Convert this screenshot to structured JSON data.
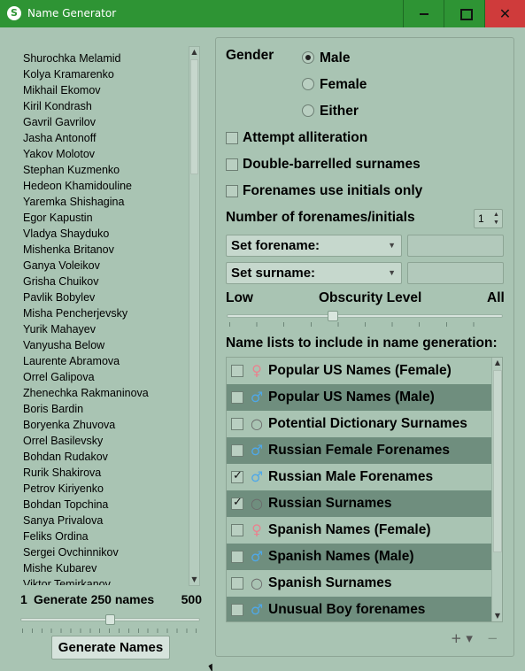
{
  "window": {
    "title": "Name Generator",
    "app_icon_letter": "S",
    "minimize_icon": "minimize-icon",
    "maximize_icon": "maximize-icon",
    "close_label": "✕"
  },
  "names": [
    "Shurochka Melamid",
    "Kolya Kramarenko",
    "Mikhail Ekomov",
    "Kiril Kondrash",
    "Gavril Gavrilov",
    "Jasha Antonoff",
    "Yakov Molotov",
    "Stephan Kuzmenko",
    "Hedeon Khamidouline",
    "Yaremka Shishagina",
    "Egor Kapustin",
    "Vladya Shayduko",
    "Mishenka Britanov",
    "Ganya Voleikov",
    "Grisha Chuikov",
    "Pavlik Bobylev",
    "Misha Pencherjevsky",
    "Yurik Mahayev",
    "Vanyusha Below",
    "Laurente Abramova",
    "Orrel Galipova",
    "Zhenechka Rakmaninova",
    "Boris Bardin",
    "Boryenka Zhuvova",
    "Orrel Basilevsky",
    "Bohdan Rudakov",
    "Rurik Shakirova",
    "Petrov Kiriyenko",
    "Bohdan Topchina",
    "Sanya Privalova",
    "Feliks Ordina",
    "Sergei Ovchinnikov",
    "Mishe Kubarev",
    "Viktor Temirkanov"
  ],
  "generate": {
    "min": "1",
    "label": "Generate 250 names",
    "max": "500",
    "value_fraction": 0.5,
    "button_label": "Generate Names"
  },
  "gender": {
    "label": "Gender",
    "options": [
      "Male",
      "Female",
      "Either"
    ],
    "selected": "Male"
  },
  "options": {
    "alliteration": {
      "label": "Attempt alliteration",
      "checked": false
    },
    "double_barrelled": {
      "label": "Double-barrelled surnames",
      "checked": false
    },
    "initials_only": {
      "label": "Forenames use initials only",
      "checked": false
    }
  },
  "forenames_count": {
    "label": "Number of forenames/initials",
    "value": "1"
  },
  "set_forename": {
    "label": "Set forename:",
    "value": ""
  },
  "set_surname": {
    "label": "Set surname:",
    "value": ""
  },
  "obscurity": {
    "low": "Low",
    "label": "Obscurity Level",
    "high": "All",
    "value_fraction": 0.38
  },
  "name_lists": {
    "label": "Name lists to include in name generation:",
    "items": [
      {
        "label": "Popular US Names (Female)",
        "icon": "female-icon",
        "checked": false
      },
      {
        "label": "Popular US Names (Male)",
        "icon": "male-icon",
        "checked": false
      },
      {
        "label": "Potential Dictionary Surnames",
        "icon": "circle-icon",
        "checked": false
      },
      {
        "label": "Russian Female Forenames",
        "icon": "male-icon",
        "checked": false
      },
      {
        "label": "Russian Male Forenames",
        "icon": "male-icon",
        "checked": true
      },
      {
        "label": "Russian Surnames",
        "icon": "circle-icon",
        "checked": true
      },
      {
        "label": "Spanish Names (Female)",
        "icon": "female-icon",
        "checked": false
      },
      {
        "label": "Spanish Names (Male)",
        "icon": "male-icon",
        "checked": false
      },
      {
        "label": "Spanish Surnames",
        "icon": "circle-icon",
        "checked": false
      },
      {
        "label": "Unusual Boy forenames",
        "icon": "male-icon",
        "checked": false
      }
    ],
    "add_label": "+ ▾",
    "remove_label": "−"
  },
  "colors": {
    "titlebar": "#2e9434",
    "background": "#a9c4b3",
    "row_dark": "#6f8e7e",
    "female_symbol": "#e8838f",
    "male_symbol": "#4fa8e8",
    "circle_symbol": "#6b6b6b"
  }
}
